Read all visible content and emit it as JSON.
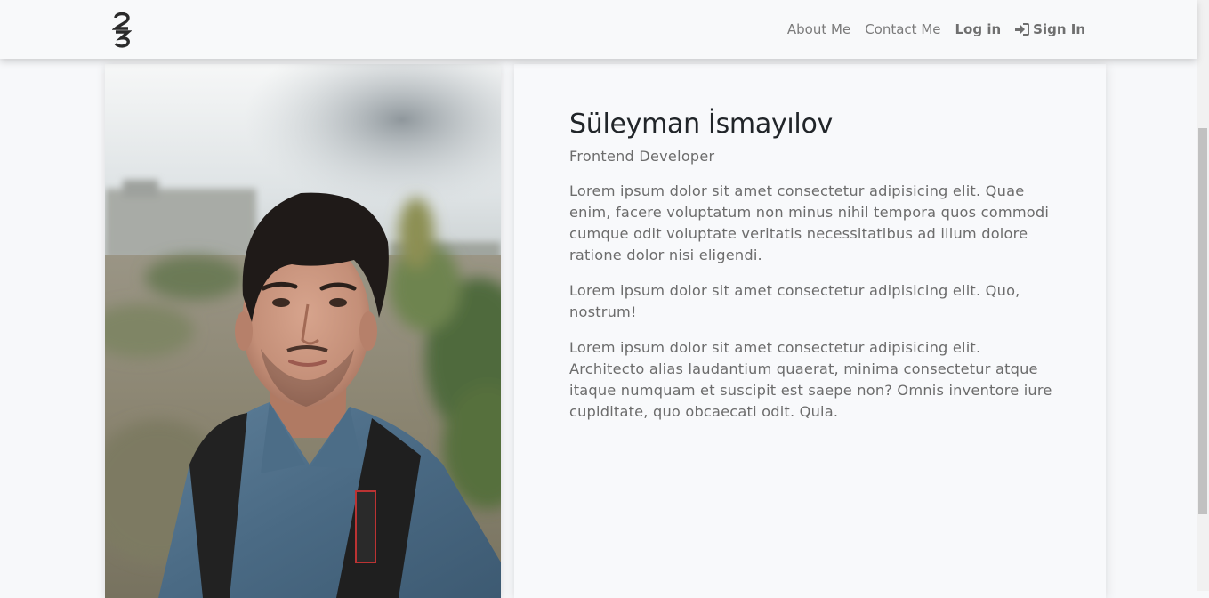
{
  "navbar": {
    "brand_text": "23",
    "links": [
      {
        "label": "About Me"
      },
      {
        "label": "Contact Me"
      },
      {
        "label": "Log in"
      },
      {
        "label": "Sign In",
        "icon": "sign-in-icon"
      }
    ]
  },
  "profile": {
    "photo_alt": "Portrait photo",
    "name": "Süleyman İsmayılov",
    "role": "Frontend Developer",
    "paragraphs": [
      "Lorem ipsum dolor sit amet consectetur adipisicing elit. Quae enim, facere voluptatum non minus nihil tempora quos commodi cumque odit voluptate veritatis necessitatibus ad illum dolore ratione dolor nisi eligendi.",
      "Lorem ipsum dolor sit amet consectetur adipisicing elit. Quo, nostrum!",
      "Lorem ipsum dolor sit amet consectetur adipisicing elit. Architecto alias laudantium quaerat, minima consectetur atque itaque numquam et suscipit est saepe non? Omnis inventore iure cupiditate, quo obcaecati odit. Quia."
    ]
  },
  "colors": {
    "background": "#f7f8fa",
    "navbar": "#f8f9fa",
    "text_dark": "#212529",
    "text_muted": "#6c6c6c"
  }
}
